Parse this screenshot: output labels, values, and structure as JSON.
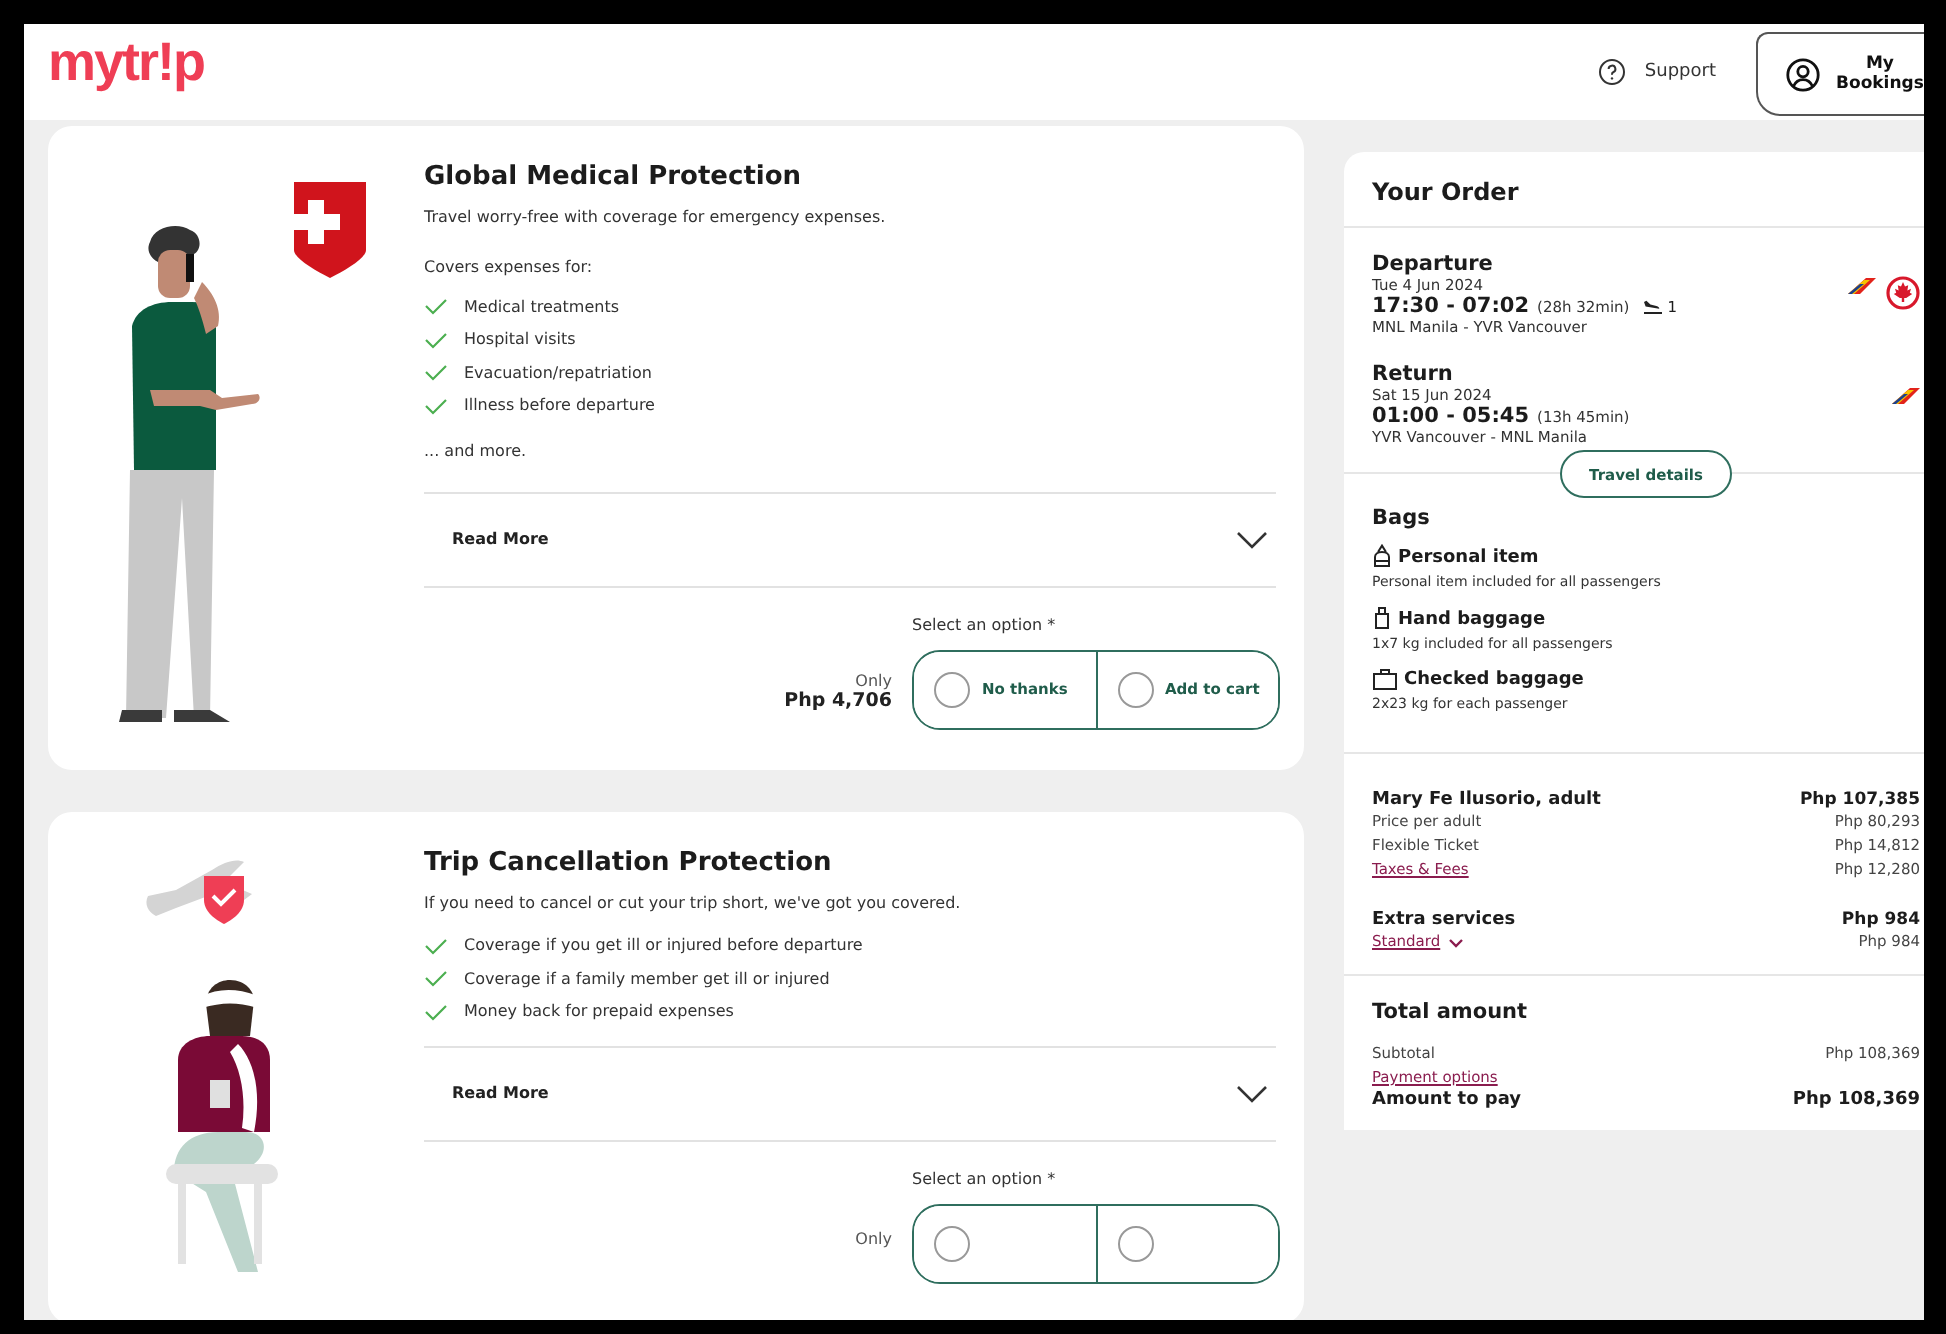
{
  "header": {
    "logo": "mytr!p",
    "support": "Support",
    "bookings": "My Bookings"
  },
  "products": [
    {
      "kind": "medical",
      "title": "Global Medical Protection",
      "description": "Travel worry-free with coverage for emergency expenses.",
      "intro": "Covers expenses for:",
      "features": [
        "Medical treatments",
        "Hospital visits",
        "Evacuation/repatriation",
        "Illness before departure"
      ],
      "more": "... and more.",
      "read_more": "Read More",
      "select_label": "Select an option *",
      "price_prefix": "Only",
      "price": "Php 4,706",
      "options": [
        {
          "label": "No thanks",
          "selected": false
        },
        {
          "label": "Add to cart",
          "selected": false
        }
      ]
    },
    {
      "kind": "cancellation",
      "title": "Trip Cancellation Protection",
      "description": "If you need to cancel or cut your trip short, we've got you covered.",
      "features": [
        "Coverage if you get ill or injured before departure",
        "Coverage if a family member get ill or injured",
        "Money back for prepaid expenses"
      ],
      "read_more": "Read More",
      "select_label": "Select an option *",
      "price_prefix": "Only",
      "options": [
        {
          "selected": false
        },
        {
          "selected": false
        }
      ]
    }
  ],
  "order": {
    "title": "Your Order",
    "flights": [
      {
        "label": "Departure",
        "date": "Tue 4 Jun 2024",
        "times": "17:30 - 07:02",
        "duration": "(28h 32min)",
        "stops": "1",
        "route": "MNL Manila - YVR Vancouver",
        "airlines": [
          {
            "kind": "stripe"
          },
          {
            "kind": "maple"
          }
        ]
      },
      {
        "label": "Return",
        "date": "Sat 15 Jun 2024",
        "times": "01:00 - 05:45",
        "duration": "(13h 45min)",
        "route": "YVR Vancouver - MNL Manila",
        "airlines": [
          {
            "kind": "stripe"
          }
        ]
      }
    ],
    "travel_details": "Travel details",
    "bags": {
      "title": "Bags",
      "items": [
        {
          "kind": "personal",
          "name": "Personal item",
          "detail": "Personal item included for all passengers"
        },
        {
          "kind": "hand",
          "name": "Hand baggage",
          "detail": "1x7 kg included for all passengers"
        },
        {
          "kind": "checked",
          "name": "Checked baggage",
          "detail": "2x23 kg for each passenger"
        }
      ]
    },
    "passenger": {
      "name": "Mary Fe Ilusorio, adult",
      "amount": "Php 107,385",
      "lines": [
        {
          "kind": "text",
          "label": "Price per adult",
          "amount": "Php 80,293"
        },
        {
          "kind": "text",
          "label": "Flexible Ticket",
          "amount": "Php 14,812"
        },
        {
          "kind": "link",
          "label": "Taxes & Fees",
          "amount": "Php 12,280"
        }
      ]
    },
    "extras": {
      "title": "Extra services",
      "amount": "Php 984",
      "option": "Standard",
      "option_amount": "Php 984"
    },
    "total": {
      "title": "Total amount",
      "lines": [
        {
          "kind": "text",
          "label": "Subtotal",
          "amount": "Php 108,369"
        },
        {
          "kind": "link",
          "label": "Payment options"
        },
        {
          "kind": "strong",
          "label": "Amount to pay",
          "amount": "Php 108,369"
        }
      ]
    }
  }
}
